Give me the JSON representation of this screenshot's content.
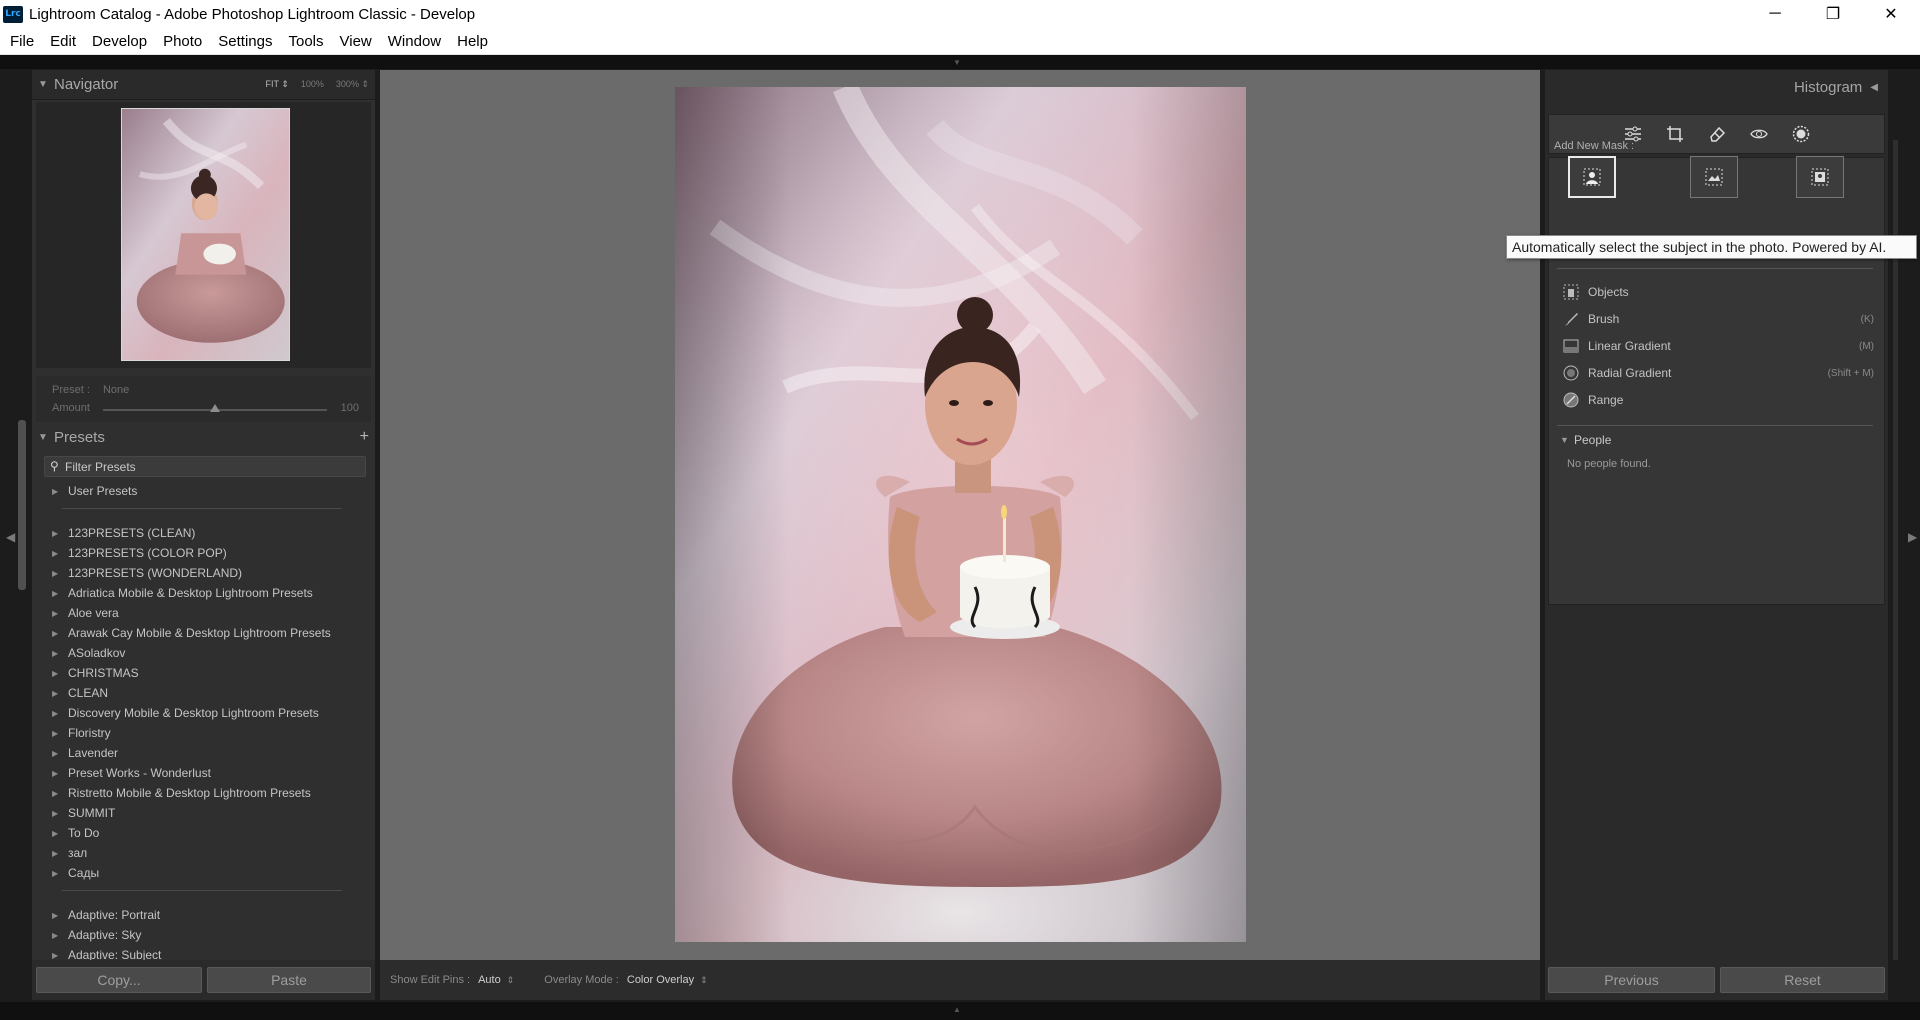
{
  "window": {
    "app_badge": "Lrc",
    "title": "Lightroom Catalog - Adobe Photoshop Lightroom Classic - Develop",
    "controls": [
      "─",
      "❐",
      "✕"
    ]
  },
  "menu": [
    "File",
    "Edit",
    "Develop",
    "Photo",
    "Settings",
    "Tools",
    "View",
    "Window",
    "Help"
  ],
  "navigator": {
    "title": "Navigator",
    "zoom_options": [
      "FIT",
      "100%",
      "300%"
    ],
    "zoom_selected": "FIT"
  },
  "preset_amount": {
    "preset_label": "Preset :",
    "preset_value": "None",
    "amount_label": "Amount",
    "amount_value": "100",
    "amount_level": 0.5
  },
  "presets": {
    "title": "Presets",
    "add_icon": "+",
    "filter_placeholder": "Filter Presets",
    "groups": [
      [
        "User Presets"
      ],
      [
        "123PRESETS (CLEAN)",
        "123PRESETS (COLOR POP)",
        "123PRESETS (WONDERLAND)",
        "Adriatica Mobile & Desktop Lightroom Presets",
        "Aloe vera",
        "Arawak Cay Mobile & Desktop Lightroom Presets",
        "ASoladkov",
        "CHRISTMAS",
        "CLEAN",
        "Discovery Mobile & Desktop Lightroom Presets",
        "Floristry",
        "Lavender",
        "Preset Works - Wonderlust",
        "Ristretto Mobile & Desktop Lightroom Presets",
        "SUMMIT",
        "To Do",
        "зал",
        "Сады"
      ],
      [
        "Adaptive: Portrait",
        "Adaptive: Sky",
        "Adaptive: Subject"
      ]
    ]
  },
  "left_bottom": {
    "copy_label": "Copy...",
    "paste_label": "Paste"
  },
  "toolbar": {
    "show_edit_pins_label": "Show Edit Pins :",
    "show_edit_pins_value": "Auto",
    "overlay_mode_label": "Overlay Mode :",
    "overlay_mode_value": "Color Overlay"
  },
  "right_panel": {
    "histogram_title": "Histogram",
    "tool_icons": [
      "edit-sliders-icon",
      "crop-icon",
      "healing-eraser-icon",
      "red-eye-icon",
      "masking-icon"
    ],
    "add_new_mask_label": "Add New Mask :",
    "mask_buttons": [
      "select-subject-icon",
      "select-sky-icon",
      "select-background-icon"
    ],
    "tools": [
      {
        "label": "Objects",
        "shortcut": "",
        "icon": "objects-icon"
      },
      {
        "label": "Brush",
        "shortcut": "(K)",
        "icon": "brush-icon"
      },
      {
        "label": "Linear Gradient",
        "shortcut": "(M)",
        "icon": "linear-gradient-icon"
      },
      {
        "label": "Radial Gradient",
        "shortcut": "(Shift + M)",
        "icon": "radial-gradient-icon"
      },
      {
        "label": "Range",
        "shortcut": "",
        "icon": "range-icon"
      }
    ],
    "people_title": "People",
    "no_people_text": "No people found."
  },
  "right_bottom": {
    "previous_label": "Previous",
    "reset_label": "Reset"
  },
  "tooltip": "Automatically select the subject in the photo. Powered by AI."
}
